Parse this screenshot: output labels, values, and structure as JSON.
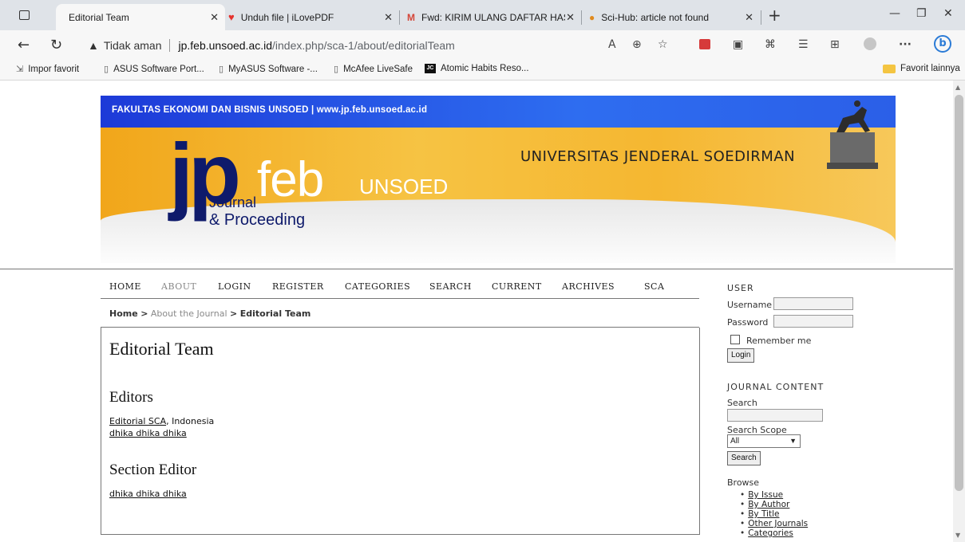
{
  "browser": {
    "tabs": [
      {
        "label": "Editorial Team",
        "active": true
      },
      {
        "label": "Unduh file | iLovePDF",
        "active": false
      },
      {
        "label": "Fwd: KIRIM ULANG DAFTAR HAS",
        "active": false
      },
      {
        "label": "Sci-Hub: article not found",
        "active": false
      }
    ],
    "address": {
      "security_label": "Tidak aman",
      "url_domain": "jp.feb.unsoed.ac.id",
      "url_path": "/index.php/sca-1/about/editorialTeam"
    },
    "bookmarks": [
      "Impor favorit",
      "ASUS Software Port...",
      "MyASUS Software -...",
      "McAfee LiveSafe",
      "Atomic Habits Reso..."
    ],
    "bookmarks_folder": "Favorit lainnya",
    "jc_badge": "JC"
  },
  "banner": {
    "top_text": "FAKULTAS EKONOMI DAN BISNIS UNSOED  |  www.jp.feb.unsoed.ac.id",
    "university": "UNIVERSITAS JENDERAL SOEDIRMAN",
    "logo_jp": "jp",
    "logo_feb": "feb",
    "logo_unsoed": "UNSOED",
    "logo_journal": "Journal",
    "logo_proceeding": "& Proceeding"
  },
  "nav": {
    "items": [
      "HOME",
      "ABOUT",
      "LOGIN",
      "REGISTER",
      "CATEGORIES",
      "SEARCH",
      "CURRENT",
      "ARCHIVES",
      "SCA"
    ]
  },
  "breadcrumb": {
    "home": "Home",
    "sep": ">",
    "about": "About the Journal",
    "current": "Editorial Team"
  },
  "main": {
    "title": "Editorial Team",
    "sections": [
      {
        "heading": "Editors",
        "people": [
          {
            "name": "Editorial SCA",
            "affiliation": ", Indonesia"
          },
          {
            "name": "dhika dhika dhika",
            "affiliation": ""
          }
        ]
      },
      {
        "heading": "Section Editor",
        "people": [
          {
            "name": "dhika dhika dhika",
            "affiliation": ""
          }
        ]
      }
    ]
  },
  "sidebar": {
    "user_heading": "USER",
    "username_label": "Username",
    "password_label": "Password",
    "remember_label": "Remember me",
    "login_button": "Login",
    "journal_heading": "JOURNAL CONTENT",
    "search_label": "Search",
    "scope_label": "Search Scope",
    "scope_value": "All",
    "search_button": "Search",
    "browse_label": "Browse",
    "browse_items": [
      "By Issue",
      "By Author",
      "By Title",
      "Other Journals",
      "Categories"
    ]
  }
}
